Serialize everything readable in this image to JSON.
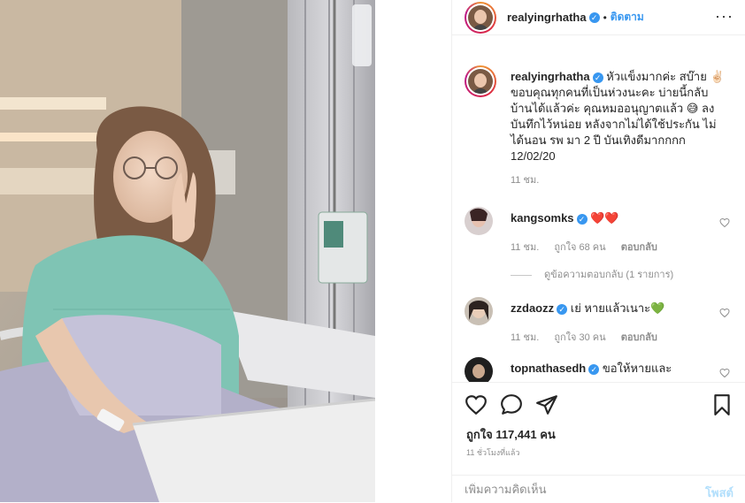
{
  "header": {
    "username": "realyingrhatha",
    "follow_label": "ติดตาม",
    "separator": "•",
    "more_label": "···"
  },
  "caption": {
    "username": "realyingrhatha",
    "text": "หัวแข็งมากค่ะ สบ๊าย ✌🏻 ขอบคุณทุกคนที่เป็นห่วงนะคะ บ่ายนี้กลับบ้านได้แล้วค่ะ คุณหมออนุญาตแล้ว 😅 ลงบันทึกไว้หน่อย หลังจากไม่ได้ใช้ประกัน ไม่ได้นอน รพ มา 2 ปี บันเทิงดีมากกกก 12/02/20",
    "time": "11 ชม."
  },
  "comments": [
    {
      "username": "kangsomks",
      "text": "❤️❤️",
      "time": "11 ชม.",
      "likes": "ถูกใจ 68 คน",
      "reply": "ตอบกลับ"
    },
    {
      "username": "zzdaozz",
      "text": "เย่ หายแล้วเนาะ💚",
      "time": "11 ชม.",
      "likes": "ถูกใจ 30 คน",
      "reply": "ตอบกลับ"
    },
    {
      "username": "topnathasedh",
      "text": "ขอให้หายและ"
    }
  ],
  "view_replies": "ดูข้อความตอบกลับ (1 รายการ)",
  "actions": {
    "likes": "ถูกใจ 117,441 คน",
    "posted_time": "11 ชั่วโมงที่แล้ว"
  },
  "composer": {
    "placeholder": "เพิ่มความคิดเห็น",
    "post_label": "โพสต์"
  },
  "colors": {
    "accent": "#3897f0",
    "heart_red": "#ed4956",
    "heart_green": "#2bbd41",
    "muted": "#8e8e8e"
  }
}
